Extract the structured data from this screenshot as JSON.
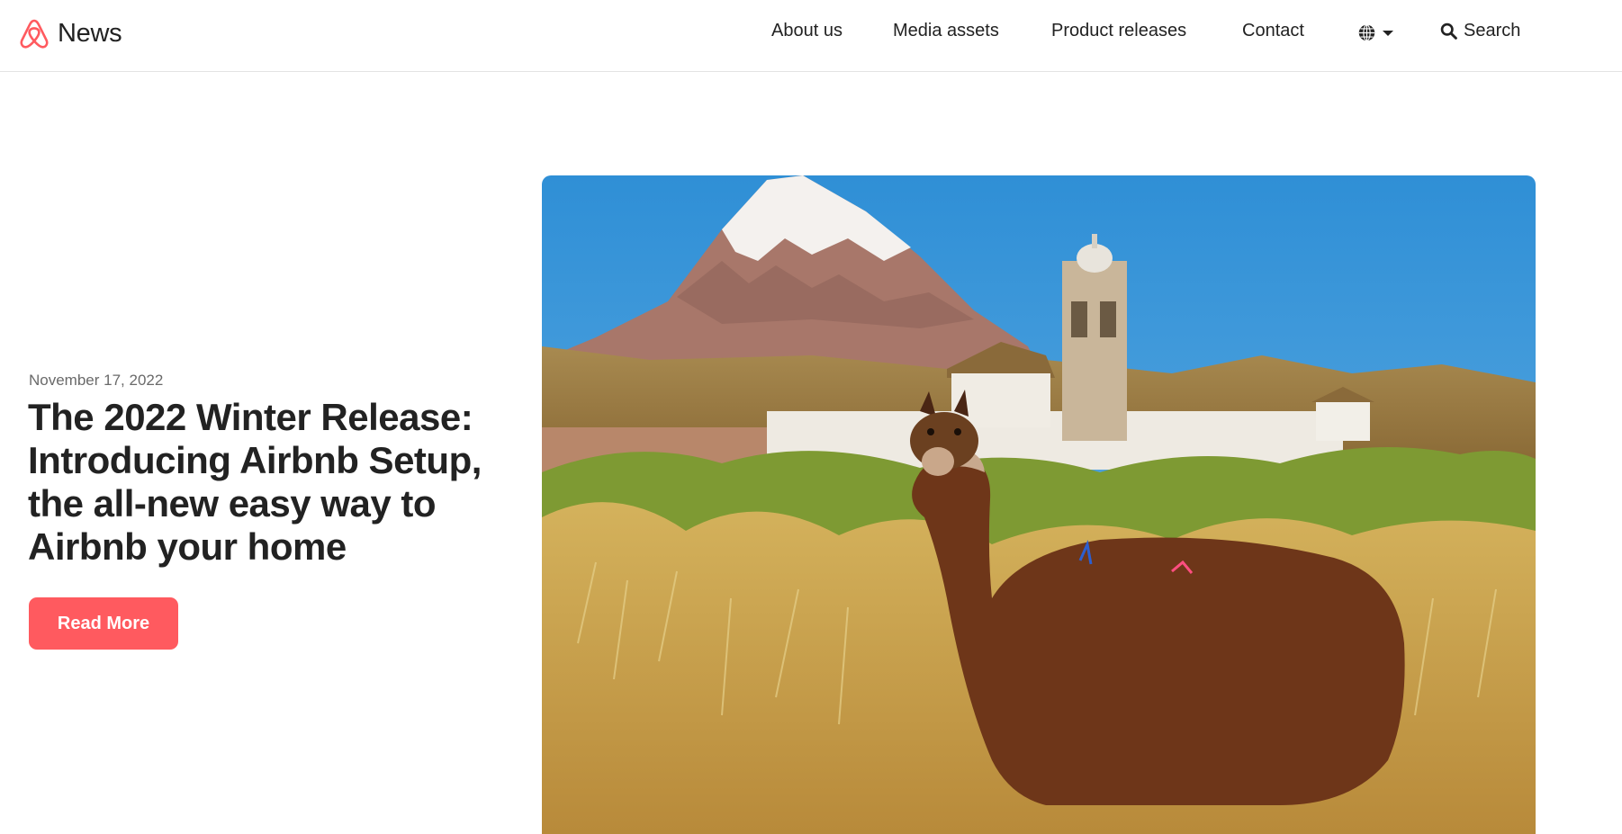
{
  "header": {
    "logo_icon": "airbnb-belo-icon",
    "brand": "News",
    "nav": [
      {
        "label": "About us"
      },
      {
        "label": "Media assets"
      },
      {
        "label": "Product releases"
      },
      {
        "label": "Contact"
      }
    ],
    "language_icon": "globe-icon",
    "search_label": "Search",
    "search_icon": "search-icon"
  },
  "hero": {
    "date": "November 17, 2022",
    "title": "The 2022 Winter Release: Introducing Airbnb Setup, the all-new easy way to Airbnb your home",
    "button_label": "Read More",
    "image_subject": "llama-mountain-church-photo"
  },
  "colors": {
    "brand": "#ff5a5f",
    "text": "#222222",
    "muted": "#6a6a6a"
  }
}
